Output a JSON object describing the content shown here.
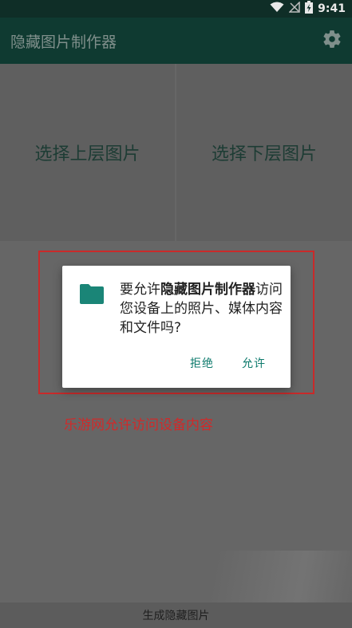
{
  "status_bar": {
    "time": "9:41",
    "icons": [
      "wifi-icon",
      "signal-off-icon",
      "battery-charging-icon"
    ]
  },
  "app_bar": {
    "title": "隐藏图片制作器",
    "settings_icon": "gear-icon"
  },
  "pickers": {
    "upper_label": "选择上层图片",
    "lower_label": "选择下层图片"
  },
  "dialog": {
    "message_prefix": "要允许",
    "app_name": "隐藏图片制作器",
    "message_suffix": "访问您设备上的照片、媒体内容和文件吗?",
    "icon": "folder-icon",
    "deny_label": "拒绝",
    "allow_label": "允许"
  },
  "annotation": {
    "text": "乐游网允许访问设备内容"
  },
  "bottom": {
    "generate_label": "生成隐藏图片"
  },
  "colors": {
    "accent": "#0d7a6c",
    "folder": "#1a8577",
    "highlight": "#c92a2a",
    "app_bar": "#0f3a31"
  }
}
